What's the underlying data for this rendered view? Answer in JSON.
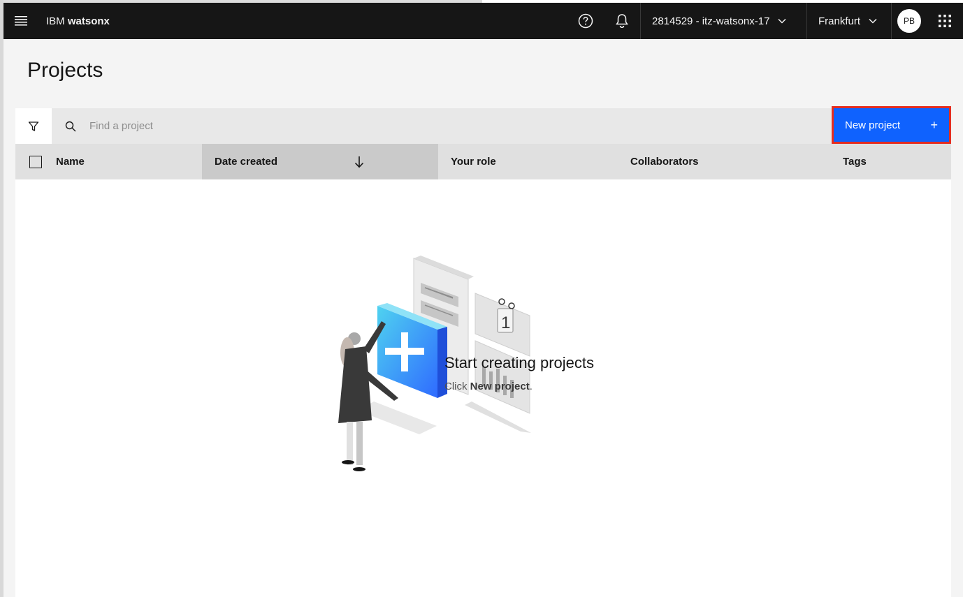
{
  "header": {
    "brand_prefix": "IBM",
    "brand_name": "watsonx",
    "account": "2814529 - itz-watsonx-17",
    "region": "Frankfurt",
    "avatar_initials": "PB"
  },
  "page": {
    "title": "Projects"
  },
  "toolbar": {
    "search_placeholder": "Find a project",
    "new_project_label": "New project",
    "new_project_icon": "+"
  },
  "table": {
    "columns": [
      "Name",
      "Date created",
      "Your role",
      "Collaborators",
      "Tags"
    ],
    "sort_column": "Date created",
    "sort_direction": "descending"
  },
  "empty_state": {
    "title": "Start creating projects",
    "sub_prefix": "Click ",
    "sub_bold": "New project",
    "sub_suffix": "."
  },
  "colors": {
    "topbar": "#161616",
    "primary_button": "#0f62fe",
    "highlight_border": "#e52d1f"
  },
  "icons": [
    "menu-icon",
    "help-icon",
    "notification-icon",
    "chevron-down-icon",
    "app-switcher-icon",
    "filter-icon",
    "search-icon",
    "sort-arrow-down-icon",
    "add-icon"
  ]
}
